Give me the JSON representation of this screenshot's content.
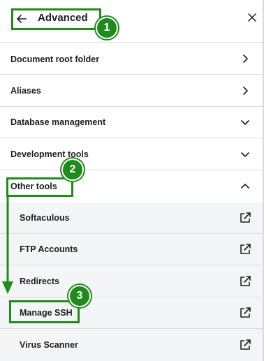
{
  "header": {
    "title": "Advanced",
    "back_icon": "arrow-left-icon",
    "close_icon": "close-icon"
  },
  "menu": {
    "items": [
      {
        "label": "Document root folder",
        "icon": "chevron-right-icon"
      },
      {
        "label": "Aliases",
        "icon": "chevron-right-icon"
      },
      {
        "label": "Database management",
        "icon": "chevron-down-icon"
      },
      {
        "label": "Development tools",
        "icon": "chevron-down-icon"
      },
      {
        "label": "Other tools",
        "icon": "chevron-up-icon",
        "expanded": true
      }
    ],
    "sub_items": [
      {
        "label": "Softaculous",
        "icon": "external-link-icon"
      },
      {
        "label": "FTP Accounts",
        "icon": "external-link-icon"
      },
      {
        "label": "Redirects",
        "icon": "external-link-icon"
      },
      {
        "label": "Manage SSH",
        "icon": "external-link-icon"
      },
      {
        "label": "Virus Scanner",
        "icon": "external-link-icon"
      }
    ]
  },
  "annotations": {
    "steps": [
      "1",
      "2",
      "3"
    ],
    "color": "#208a1c"
  },
  "colors": {
    "sub_background": "#f4f5f6",
    "divider": "#dadce0",
    "text": "#1d1e20"
  }
}
